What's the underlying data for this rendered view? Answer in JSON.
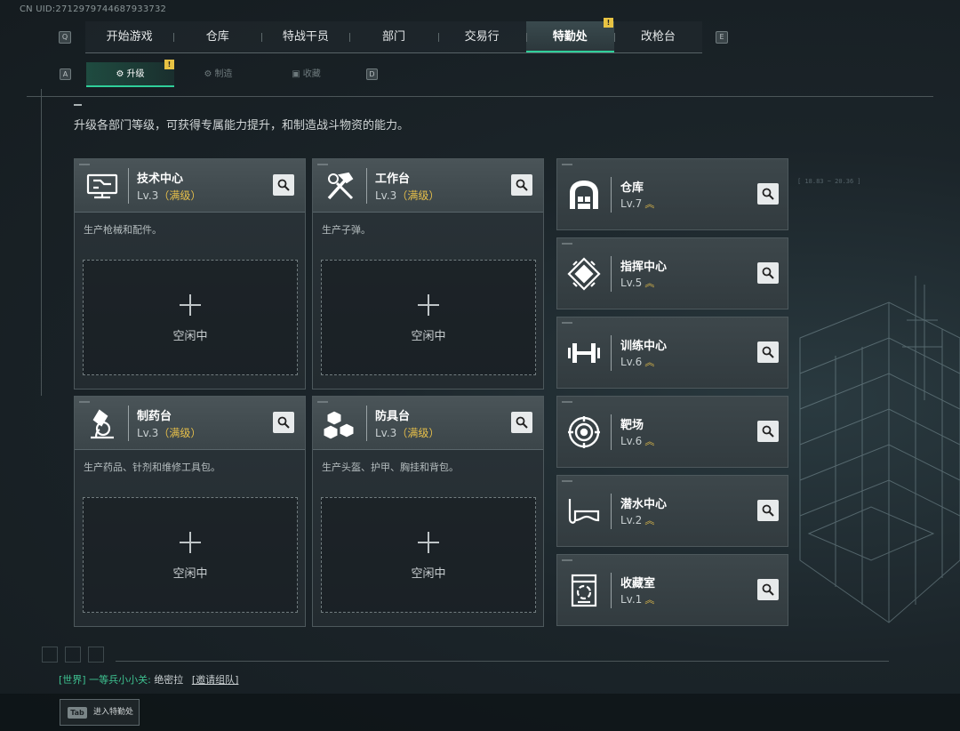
{
  "uid_text": "CN UID:2712979744687933732",
  "keys": {
    "q": "Q",
    "e": "E",
    "a": "A",
    "d": "D"
  },
  "top_tabs": [
    {
      "label": "开始游戏"
    },
    {
      "label": "仓库"
    },
    {
      "label": "特战干员"
    },
    {
      "label": "部门"
    },
    {
      "label": "交易行"
    },
    {
      "label": "特勤处",
      "active": true,
      "alert": true
    },
    {
      "label": "改枪台"
    }
  ],
  "alert_mark": "!",
  "sub_tabs": [
    {
      "label": "升级",
      "icon": "upgrade-icon",
      "active": true,
      "alert": true
    },
    {
      "label": "制造",
      "icon": "gear-icon"
    },
    {
      "label": "收藏",
      "icon": "collection-icon"
    }
  ],
  "description": "升级各部门等级，可获得专属能力提升，和制造战斗物资的能力。",
  "production_facilities": [
    {
      "name": "技术中心",
      "level": "Lv.3",
      "max_tag": "（满级）",
      "desc": "生产枪械和配件。",
      "icon": "computer-icon",
      "status": "空闲中"
    },
    {
      "name": "工作台",
      "level": "Lv.3",
      "max_tag": "（满级）",
      "desc": "生产子弹。",
      "icon": "tools-icon",
      "status": "空闲中"
    },
    {
      "name": "制药台",
      "level": "Lv.3",
      "max_tag": "（满级）",
      "desc": "生产药品、针剂和维修工具包。",
      "icon": "microscope-icon",
      "status": "空闲中"
    },
    {
      "name": "防具台",
      "level": "Lv.3",
      "max_tag": "（满级）",
      "desc": "生产头盔、护甲、胸挂和背包。",
      "icon": "cubes-icon",
      "status": "空闲中"
    }
  ],
  "other_facilities": [
    {
      "name": "仓库",
      "level": "Lv.7",
      "icon": "warehouse-icon"
    },
    {
      "name": "指挥中心",
      "level": "Lv.5",
      "icon": "chip-icon"
    },
    {
      "name": "训练中心",
      "level": "Lv.6",
      "icon": "dumbbell-icon"
    },
    {
      "name": "靶场",
      "level": "Lv.6",
      "icon": "target-icon"
    },
    {
      "name": "潜水中心",
      "level": "Lv.2",
      "icon": "diving-mask-icon"
    },
    {
      "name": "收藏室",
      "level": "Lv.1",
      "icon": "recycle-box-icon"
    }
  ],
  "upgrade_mark": "︽",
  "chat": {
    "channel": "[世界]",
    "speaker": "一等兵小小关:",
    "message": "绝密拉",
    "action": "[邀请组队]"
  },
  "bottom_hint": {
    "key": "Tab",
    "label": "进入特勤处"
  },
  "hud_text": "[ 18.83  ~  20.36 ]",
  "colors": {
    "accent": "#2fcf9a",
    "gold": "#e6bf4a",
    "alert": "#e8c343"
  }
}
